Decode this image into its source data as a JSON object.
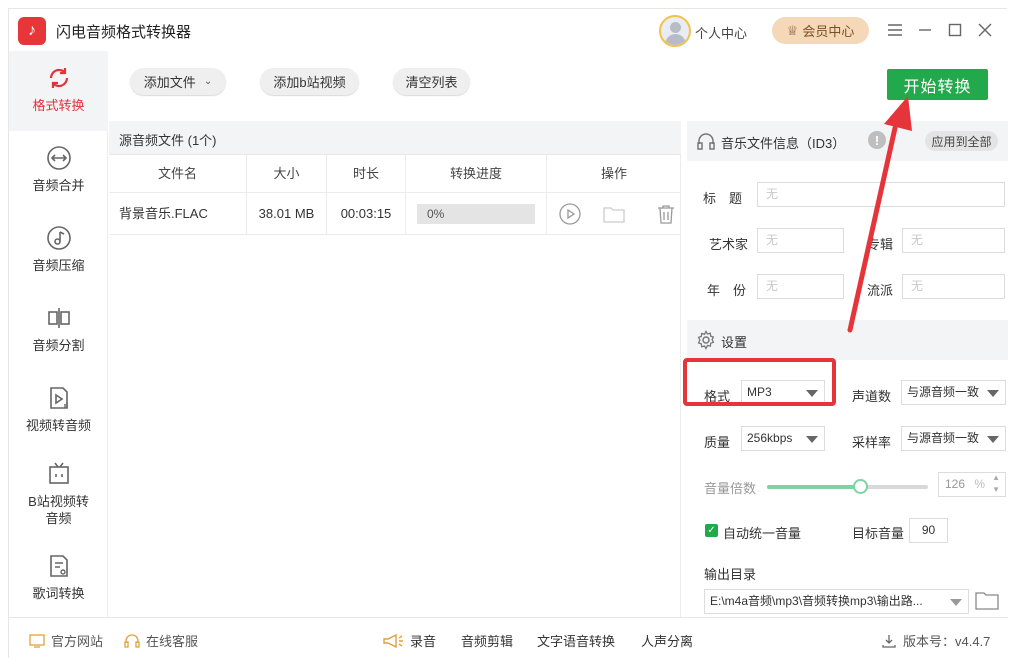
{
  "app": {
    "title": "闪电音频格式转换器",
    "personal_center": "个人中心",
    "vip_center": "会员中心"
  },
  "sidebar": {
    "items": [
      {
        "label": "格式转换",
        "active": true
      },
      {
        "label": "音频合并",
        "active": false
      },
      {
        "label": "音频压缩",
        "active": false
      },
      {
        "label": "音频分割",
        "active": false
      },
      {
        "label": "视频转音频",
        "active": false
      },
      {
        "label": "B站视频转",
        "label2": "音频",
        "active": false
      },
      {
        "label": "歌词转换",
        "active": false
      }
    ]
  },
  "toolbar": {
    "add_file": "添加文件",
    "add_bilibili": "添加b站视频",
    "clear_list": "清空列表",
    "start": "开始转换"
  },
  "file_panel": {
    "title": "源音频文件 (1个)",
    "columns": [
      "文件名",
      "大小",
      "时长",
      "转换进度",
      "操作"
    ],
    "rows": [
      {
        "name": "背景音乐.FLAC",
        "size": "38.01 MB",
        "duration": "00:03:15",
        "progress": "0%",
        "progress_value": 0
      }
    ]
  },
  "music_info": {
    "title": "音乐文件信息（ID3）",
    "apply_all": "应用到全部",
    "warn": "!",
    "fields": {
      "title_label": "标　题",
      "artist_label": "艺术家",
      "album_label": "专辑",
      "year_label": "年　份",
      "genre_label": "流派",
      "placeholder": "无"
    }
  },
  "settings": {
    "title": "设置",
    "format_label": "格式",
    "format_value": "MP3",
    "channel_label": "声道数",
    "channel_value": "与源音频一致",
    "quality_label": "质量",
    "quality_value": "256kbps",
    "samplerate_label": "采样率",
    "samplerate_value": "与源音频一致",
    "volume_label": "音量倍数",
    "volume_value": "126",
    "volume_unit": "%",
    "volume_fraction": 0.58,
    "auto_volume_label": "自动统一音量",
    "target_volume_label": "目标音量",
    "target_volume_value": "90",
    "output_dir_label": "输出目录",
    "output_dir_value": "E:\\m4a音频\\mp3\\音频转换mp3\\输出路..."
  },
  "bottom_bar": {
    "website": "官方网站",
    "service": "在线客服",
    "record": "录音",
    "clip": "音频剪辑",
    "tts": "文字语音转换",
    "vocal": "人声分离",
    "version": "版本号：v4.4.7"
  },
  "colors": {
    "accent_red": "#e2333a",
    "start_green": "#22a94b",
    "slider_green": "#7dd3a1",
    "highlight_red": "#e5353b"
  }
}
